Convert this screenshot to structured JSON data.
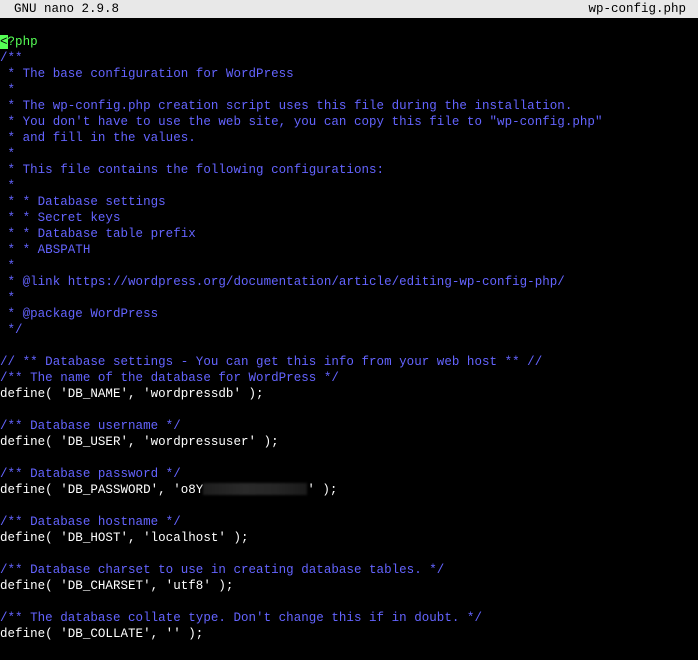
{
  "titlebar": {
    "app": "GNU nano 2.9.8",
    "filename": "wp-config.php"
  },
  "colors": {
    "comment": "#6464ff",
    "php_tag": "#55ff55",
    "cursor": "#55ff55",
    "text": "#ffffff",
    "background": "#000000",
    "titlebar_bg": "#e8e8e8"
  },
  "lines": [
    {
      "type": "php",
      "cursor_char": "<",
      "text": "?php"
    },
    {
      "type": "comment",
      "text": "/**"
    },
    {
      "type": "comment",
      "text": " * The base configuration for WordPress"
    },
    {
      "type": "comment",
      "text": " *"
    },
    {
      "type": "comment",
      "text": " * The wp-config.php creation script uses this file during the installation."
    },
    {
      "type": "comment",
      "text": " * You don't have to use the web site, you can copy this file to \"wp-config.php\""
    },
    {
      "type": "comment",
      "text": " * and fill in the values."
    },
    {
      "type": "comment",
      "text": " *"
    },
    {
      "type": "comment",
      "text": " * This file contains the following configurations:"
    },
    {
      "type": "comment",
      "text": " *"
    },
    {
      "type": "comment",
      "text": " * * Database settings"
    },
    {
      "type": "comment",
      "text": " * * Secret keys"
    },
    {
      "type": "comment",
      "text": " * * Database table prefix"
    },
    {
      "type": "comment",
      "text": " * * ABSPATH"
    },
    {
      "type": "comment",
      "text": " *"
    },
    {
      "type": "comment",
      "text": " * @link https://wordpress.org/documentation/article/editing-wp-config-php/"
    },
    {
      "type": "comment",
      "text": " *"
    },
    {
      "type": "comment",
      "text": " * @package WordPress"
    },
    {
      "type": "comment",
      "text": " */"
    },
    {
      "type": "blank",
      "text": ""
    },
    {
      "type": "comment",
      "text": "// ** Database settings - You can get this info from your web host ** //"
    },
    {
      "type": "comment",
      "text": "/** The name of the database for WordPress */"
    },
    {
      "type": "code",
      "text": "define( 'DB_NAME', 'wordpressdb' );"
    },
    {
      "type": "blank",
      "text": ""
    },
    {
      "type": "comment",
      "text": "/** Database username */"
    },
    {
      "type": "code",
      "text": "define( 'DB_USER', 'wordpressuser' );"
    },
    {
      "type": "blank",
      "text": ""
    },
    {
      "type": "comment",
      "text": "/** Database password */"
    },
    {
      "type": "code-redacted",
      "before": "define( 'DB_PASSWORD', 'o8Y",
      "after": "' );"
    },
    {
      "type": "blank",
      "text": ""
    },
    {
      "type": "comment",
      "text": "/** Database hostname */"
    },
    {
      "type": "code",
      "text": "define( 'DB_HOST', 'localhost' );"
    },
    {
      "type": "blank",
      "text": ""
    },
    {
      "type": "comment",
      "text": "/** Database charset to use in creating database tables. */"
    },
    {
      "type": "code",
      "text": "define( 'DB_CHARSET', 'utf8' );"
    },
    {
      "type": "blank",
      "text": ""
    },
    {
      "type": "comment",
      "text": "/** The database collate type. Don't change this if in doubt. */"
    },
    {
      "type": "code",
      "text": "define( 'DB_COLLATE', '' );"
    }
  ]
}
